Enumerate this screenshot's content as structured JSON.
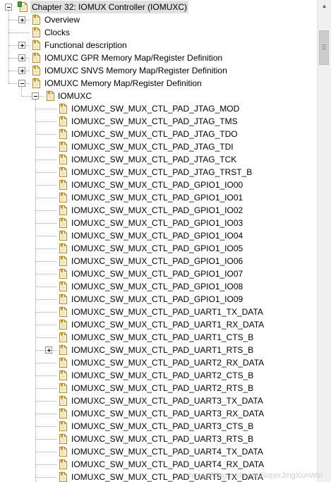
{
  "tree": {
    "root": {
      "label": "Chapter 32: IOMUX Controller (IOMUXC)",
      "selected": true,
      "expanded": true
    },
    "children": [
      {
        "label": "Overview",
        "expander": "plus"
      },
      {
        "label": "Clocks",
        "expander": "none"
      },
      {
        "label": "Functional description",
        "expander": "plus"
      },
      {
        "label": "IOMUXC GPR Memory Map/Register Definition",
        "expander": "plus"
      },
      {
        "label": "IOMUXC SNVS Memory Map/Register Definition",
        "expander": "plus"
      },
      {
        "label": "IOMUXC Memory Map/Register Definition",
        "expander": "minus"
      }
    ],
    "subfolder": {
      "label": "IOMUXC",
      "expander": "minus"
    },
    "registers": [
      {
        "label": "IOMUXC_SW_MUX_CTL_PAD_JTAG_MOD"
      },
      {
        "label": "IOMUXC_SW_MUX_CTL_PAD_JTAG_TMS"
      },
      {
        "label": "IOMUXC_SW_MUX_CTL_PAD_JTAG_TDO"
      },
      {
        "label": "IOMUXC_SW_MUX_CTL_PAD_JTAG_TDI"
      },
      {
        "label": "IOMUXC_SW_MUX_CTL_PAD_JTAG_TCK"
      },
      {
        "label": "IOMUXC_SW_MUX_CTL_PAD_JTAG_TRST_B"
      },
      {
        "label": "IOMUXC_SW_MUX_CTL_PAD_GPIO1_IO00"
      },
      {
        "label": "IOMUXC_SW_MUX_CTL_PAD_GPIO1_IO01"
      },
      {
        "label": "IOMUXC_SW_MUX_CTL_PAD_GPIO1_IO02"
      },
      {
        "label": "IOMUXC_SW_MUX_CTL_PAD_GPIO1_IO03"
      },
      {
        "label": "IOMUXC_SW_MUX_CTL_PAD_GPIO1_IO04"
      },
      {
        "label": "IOMUXC_SW_MUX_CTL_PAD_GPIO1_IO05"
      },
      {
        "label": "IOMUXC_SW_MUX_CTL_PAD_GPIO1_IO06"
      },
      {
        "label": "IOMUXC_SW_MUX_CTL_PAD_GPIO1_IO07"
      },
      {
        "label": "IOMUXC_SW_MUX_CTL_PAD_GPIO1_IO08"
      },
      {
        "label": "IOMUXC_SW_MUX_CTL_PAD_GPIO1_IO09"
      },
      {
        "label": "IOMUXC_SW_MUX_CTL_PAD_UART1_TX_DATA"
      },
      {
        "label": "IOMUXC_SW_MUX_CTL_PAD_UART1_RX_DATA"
      },
      {
        "label": "IOMUXC_SW_MUX_CTL_PAD_UART1_CTS_B"
      },
      {
        "label": "IOMUXC_SW_MUX_CTL_PAD_UART1_RTS_B",
        "expander": "plus"
      },
      {
        "label": "IOMUXC_SW_MUX_CTL_PAD_UART2_RX_DATA"
      },
      {
        "label": "IOMUXC_SW_MUX_CTL_PAD_UART2_CTS_B"
      },
      {
        "label": "IOMUXC_SW_MUX_CTL_PAD_UART2_RTS_B"
      },
      {
        "label": "IOMUXC_SW_MUX_CTL_PAD_UART3_TX_DATA"
      },
      {
        "label": "IOMUXC_SW_MUX_CTL_PAD_UART3_RX_DATA"
      },
      {
        "label": "IOMUXC_SW_MUX_CTL_PAD_UART3_CTS_B"
      },
      {
        "label": "IOMUXC_SW_MUX_CTL_PAD_UART3_RTS_B"
      },
      {
        "label": "IOMUXC_SW_MUX_CTL_PAD_UART4_TX_DATA"
      },
      {
        "label": "IOMUXC_SW_MUX_CTL_PAD_UART4_RX_DATA"
      },
      {
        "label": "IOMUXC_SW_MUX_CTL_PAD_UART5_TX_DATA"
      }
    ]
  },
  "icons": {
    "chapter": "book-page-icon",
    "section": "bookmark-page-icon",
    "expand": "plus-expander-icon",
    "collapse": "minus-expander-icon"
  },
  "colors": {
    "selection": "#e0e0e0",
    "page_fill": "#fff7dc",
    "page_outline": "#b58a2b",
    "tab_green": "#3fa535",
    "tab_orange": "#d7901c",
    "tree_lines": "#a0a0a0"
  },
  "watermark": "https://blog.csdn.net/SuperJingXunWei"
}
